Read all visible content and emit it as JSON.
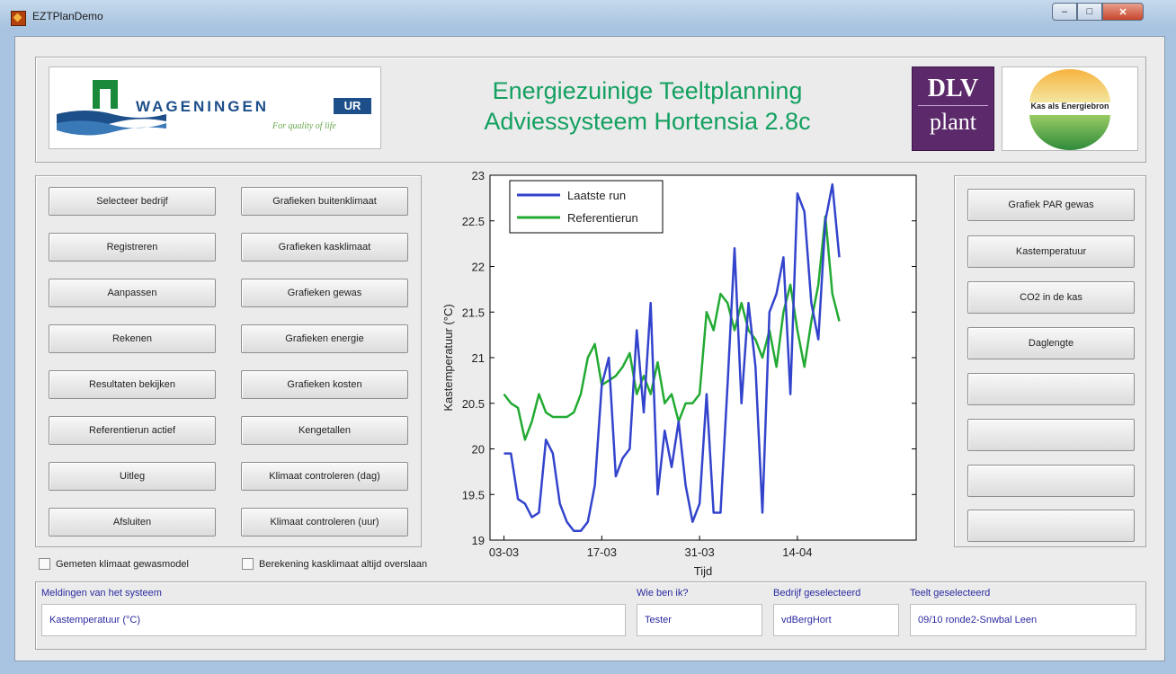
{
  "window": {
    "title": "EZTPlanDemo",
    "controls": {
      "min": "–",
      "max": "□",
      "close": "✕"
    }
  },
  "header": {
    "title_line1": "Energiezuinige Teeltplanning",
    "title_line2": "Adviessysteem Hortensia 2.8c",
    "wur_logo_text": "WAGENINGEN",
    "wur_logo_ur": "UR",
    "wur_tagline": "For quality of life",
    "dlv_top": "DLV",
    "dlv_bottom": "plant",
    "kas_logo_text": "Kas als Energiebron"
  },
  "left_buttons": {
    "col1": [
      "Selecteer bedrijf",
      "Registreren",
      "Aanpassen",
      "Rekenen",
      "Resultaten bekijken",
      "Referentierun actief",
      "Uitleg",
      "Afsluiten"
    ],
    "col2": [
      "Grafieken buitenklimaat",
      "Grafieken kasklimaat",
      "Grafieken gewas",
      "Grafieken energie",
      "Grafieken kosten",
      "Kengetallen",
      "Klimaat controleren (dag)",
      "Klimaat controleren (uur)"
    ]
  },
  "right_buttons": [
    "Grafiek PAR gewas",
    "Kastemperatuur",
    "CO2 in de kas",
    "Daglengte",
    "",
    "",
    "",
    ""
  ],
  "checkboxes": {
    "c1": "Gemeten klimaat gewasmodel",
    "c2": "Berekening kasklimaat altijd overslaan"
  },
  "status": {
    "messages_label": "Meldingen van het systeem",
    "messages_value": "Kastemperatuur (°C)",
    "who_label": "Wie ben ik?",
    "who_value": "Tester",
    "company_label": "Bedrijf geselecteerd",
    "company_value": "vdBergHort",
    "crop_label": "Teelt geselecteerd",
    "crop_value": "09/10 ronde2-Snwbal Leen"
  },
  "colors": {
    "title_green": "#13a060",
    "series_blue": "#3344cc",
    "series_green": "#22aa33",
    "label_blue": "#2a2aa0"
  },
  "chart_data": {
    "type": "line",
    "xlabel": "Tijd",
    "ylabel": "Kastemperatuur (°C)",
    "ylim": [
      19,
      23
    ],
    "yticks": [
      "19",
      "19.5",
      "20",
      "20.5",
      "21",
      "21.5",
      "22",
      "22.5",
      "23"
    ],
    "xlim": [
      "2010-03-01",
      "2010-05-01"
    ],
    "xticks": [
      "03-03",
      "17-03",
      "31-03",
      "14-04"
    ],
    "xtick_dates": [
      "2010-03-03",
      "2010-03-17",
      "2010-03-31",
      "2010-04-14"
    ],
    "legend_position": "top-left",
    "grid": false,
    "series": [
      {
        "name": "Laatste run",
        "color": "#3344cc",
        "points": [
          [
            "2010-03-03",
            19.95
          ],
          [
            "2010-03-04",
            19.95
          ],
          [
            "2010-03-05",
            19.45
          ],
          [
            "2010-03-06",
            19.4
          ],
          [
            "2010-03-07",
            19.25
          ],
          [
            "2010-03-08",
            19.3
          ],
          [
            "2010-03-09",
            20.1
          ],
          [
            "2010-03-10",
            19.95
          ],
          [
            "2010-03-11",
            19.4
          ],
          [
            "2010-03-12",
            19.2
          ],
          [
            "2010-03-13",
            19.1
          ],
          [
            "2010-03-14",
            19.1
          ],
          [
            "2010-03-15",
            19.2
          ],
          [
            "2010-03-16",
            19.6
          ],
          [
            "2010-03-17",
            20.7
          ],
          [
            "2010-03-18",
            21.0
          ],
          [
            "2010-03-19",
            19.7
          ],
          [
            "2010-03-20",
            19.9
          ],
          [
            "2010-03-21",
            20.0
          ],
          [
            "2010-03-22",
            21.3
          ],
          [
            "2010-03-23",
            20.4
          ],
          [
            "2010-03-24",
            21.6
          ],
          [
            "2010-03-25",
            19.5
          ],
          [
            "2010-03-26",
            20.2
          ],
          [
            "2010-03-27",
            19.8
          ],
          [
            "2010-03-28",
            20.3
          ],
          [
            "2010-03-29",
            19.6
          ],
          [
            "2010-03-30",
            19.2
          ],
          [
            "2010-03-31",
            19.4
          ],
          [
            "2010-04-01",
            20.6
          ],
          [
            "2010-04-02",
            19.3
          ],
          [
            "2010-04-03",
            19.3
          ],
          [
            "2010-04-04",
            20.7
          ],
          [
            "2010-04-05",
            22.2
          ],
          [
            "2010-04-06",
            20.5
          ],
          [
            "2010-04-07",
            21.6
          ],
          [
            "2010-04-08",
            20.9
          ],
          [
            "2010-04-09",
            19.3
          ],
          [
            "2010-04-10",
            21.5
          ],
          [
            "2010-04-11",
            21.7
          ],
          [
            "2010-04-12",
            22.1
          ],
          [
            "2010-04-13",
            20.6
          ],
          [
            "2010-04-14",
            22.8
          ],
          [
            "2010-04-15",
            22.6
          ],
          [
            "2010-04-16",
            21.6
          ],
          [
            "2010-04-17",
            21.2
          ],
          [
            "2010-04-18",
            22.5
          ],
          [
            "2010-04-19",
            22.9
          ],
          [
            "2010-04-20",
            22.1
          ]
        ]
      },
      {
        "name": "Referentierun",
        "color": "#22aa33",
        "points": [
          [
            "2010-03-03",
            20.6
          ],
          [
            "2010-03-04",
            20.5
          ],
          [
            "2010-03-05",
            20.45
          ],
          [
            "2010-03-06",
            20.1
          ],
          [
            "2010-03-07",
            20.3
          ],
          [
            "2010-03-08",
            20.6
          ],
          [
            "2010-03-09",
            20.4
          ],
          [
            "2010-03-10",
            20.35
          ],
          [
            "2010-03-11",
            20.35
          ],
          [
            "2010-03-12",
            20.35
          ],
          [
            "2010-03-13",
            20.4
          ],
          [
            "2010-03-14",
            20.6
          ],
          [
            "2010-03-15",
            21.0
          ],
          [
            "2010-03-16",
            21.15
          ],
          [
            "2010-03-17",
            20.7
          ],
          [
            "2010-03-18",
            20.75
          ],
          [
            "2010-03-19",
            20.8
          ],
          [
            "2010-03-20",
            20.9
          ],
          [
            "2010-03-21",
            21.05
          ],
          [
            "2010-03-22",
            20.6
          ],
          [
            "2010-03-23",
            20.8
          ],
          [
            "2010-03-24",
            20.6
          ],
          [
            "2010-03-25",
            20.95
          ],
          [
            "2010-03-26",
            20.5
          ],
          [
            "2010-03-27",
            20.6
          ],
          [
            "2010-03-28",
            20.3
          ],
          [
            "2010-03-29",
            20.5
          ],
          [
            "2010-03-30",
            20.5
          ],
          [
            "2010-03-31",
            20.6
          ],
          [
            "2010-04-01",
            21.5
          ],
          [
            "2010-04-02",
            21.3
          ],
          [
            "2010-04-03",
            21.7
          ],
          [
            "2010-04-04",
            21.6
          ],
          [
            "2010-04-05",
            21.3
          ],
          [
            "2010-04-06",
            21.6
          ],
          [
            "2010-04-07",
            21.3
          ],
          [
            "2010-04-08",
            21.2
          ],
          [
            "2010-04-09",
            21.0
          ],
          [
            "2010-04-10",
            21.3
          ],
          [
            "2010-04-11",
            20.9
          ],
          [
            "2010-04-12",
            21.5
          ],
          [
            "2010-04-13",
            21.8
          ],
          [
            "2010-04-14",
            21.3
          ],
          [
            "2010-04-15",
            20.9
          ],
          [
            "2010-04-16",
            21.4
          ],
          [
            "2010-04-17",
            21.8
          ],
          [
            "2010-04-18",
            22.55
          ],
          [
            "2010-04-19",
            21.7
          ],
          [
            "2010-04-20",
            21.4
          ]
        ]
      }
    ]
  }
}
